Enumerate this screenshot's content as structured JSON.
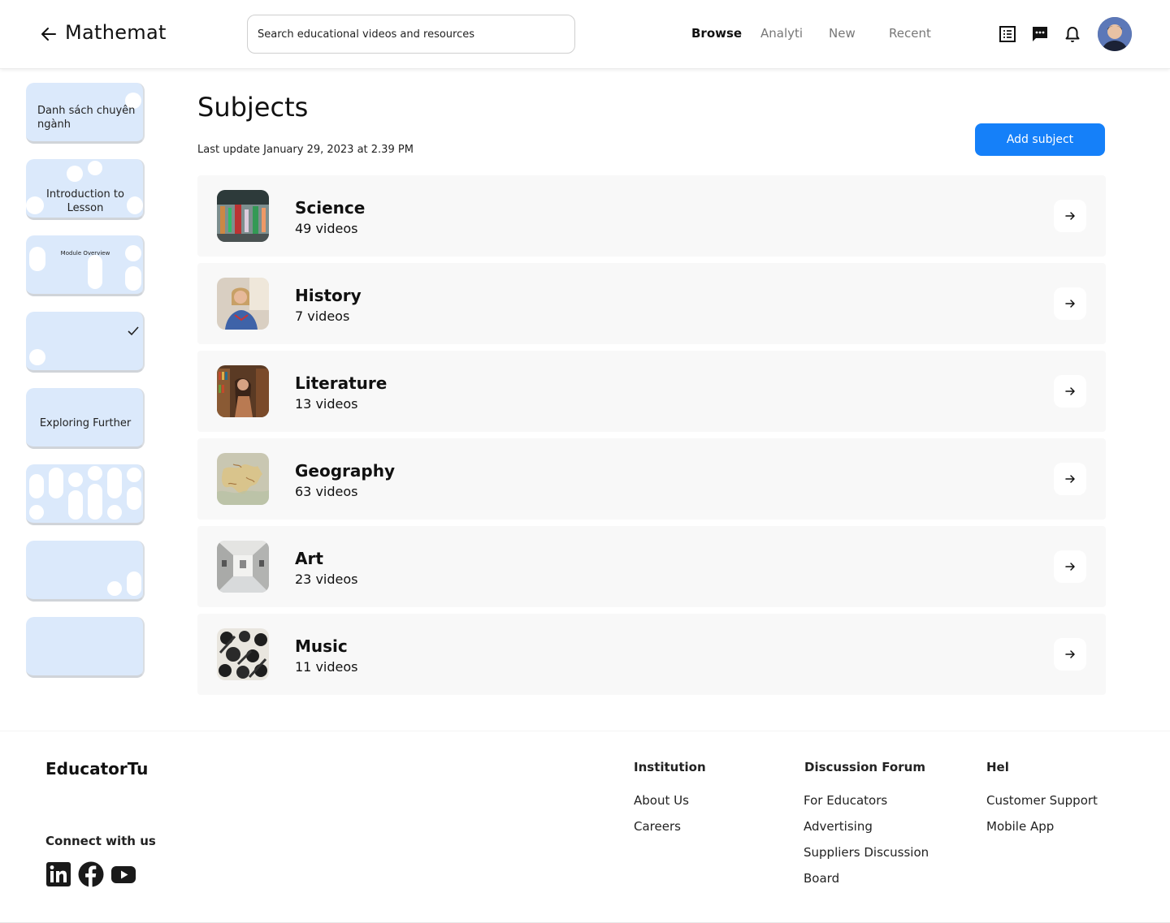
{
  "header": {
    "title": "Mathemat",
    "search_placeholder": "Search educational videos and resources",
    "nav": [
      "Browse",
      "Analyti",
      "New",
      "Recent"
    ],
    "active_nav": "Browse",
    "icons": [
      "list-icon",
      "chat-icon",
      "bell-icon"
    ]
  },
  "sidebar": {
    "thumbnails": [
      {
        "label": "Danh sách chuyên ngành"
      },
      {
        "label": "Introduction to Lesson"
      },
      {
        "label": "Module Overview"
      },
      {
        "label": "",
        "checked": true
      },
      {
        "label": "Exploring Further"
      },
      {
        "label": ""
      },
      {
        "label": ""
      },
      {
        "label": ""
      }
    ]
  },
  "main": {
    "title": "Subjects",
    "last_update": "Last update January 29, 2023 at 2.39 PM",
    "add_button": "Add subject",
    "subjects": [
      {
        "name": "Science",
        "count": "49 videos"
      },
      {
        "name": "History",
        "count": "7 videos"
      },
      {
        "name": "Literature",
        "count": "13 videos"
      },
      {
        "name": "Geography",
        "count": "63 videos"
      },
      {
        "name": "Art",
        "count": "23 videos"
      },
      {
        "name": "Music",
        "count": "11 videos"
      }
    ]
  },
  "footer": {
    "brand": "EducatorTu",
    "connect": "Connect with us",
    "social": [
      "linkedin-icon",
      "facebook-icon",
      "youtube-icon"
    ],
    "columns": [
      {
        "title": "Institution",
        "links": [
          "About Us",
          "Careers"
        ]
      },
      {
        "title": "Discussion Forum",
        "links": [
          "For Educators",
          "Advertising",
          "Suppliers Discussion",
          "Board"
        ]
      },
      {
        "title": "Hel",
        "links": [
          "Customer Support",
          "Mobile App"
        ]
      }
    ]
  },
  "colors": {
    "accent": "#1580f9",
    "thumb_bg": "#dbe9fb",
    "row_bg": "#f8f8f8"
  }
}
